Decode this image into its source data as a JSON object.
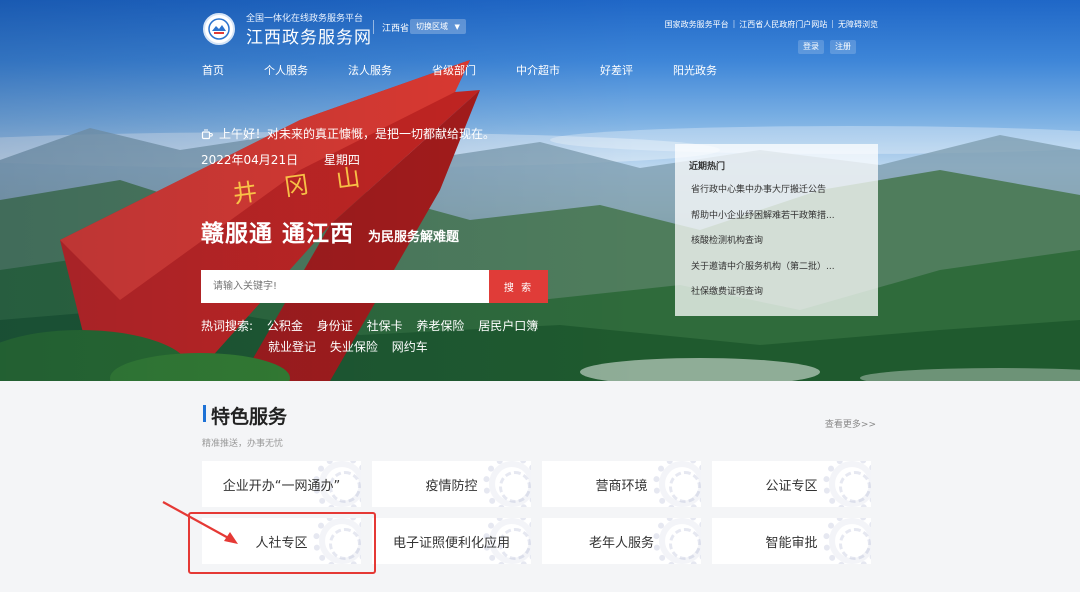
{
  "header": {
    "logo_subtitle": "全国一体化在线政务服务平台",
    "logo_title": "江西政务服务网",
    "region": "江西省",
    "region_switch": "切换区域",
    "top_links": [
      "国家政务服务平台",
      "江西省人民政府门户网站",
      "无障碍浏览"
    ],
    "login": "登录",
    "register": "注册",
    "nav": [
      "首页",
      "个人服务",
      "法人服务",
      "省级部门",
      "中介超市",
      "好差评",
      "阳光政务"
    ]
  },
  "hero": {
    "greeting": "上午好！对未来的真正慷慨，是把一切都献给现在。",
    "date": "2022年04月21日",
    "weekday": "星期四",
    "monument_text": "井冈山",
    "slogan": "赣服通 通江西",
    "slogan_sub": "为民服务解难题",
    "search_placeholder": "请输入关键字!",
    "search_button": "搜 索",
    "hot_label": "热词搜索:",
    "hot_terms_row1": [
      "公积金",
      "身份证",
      "社保卡",
      "养老保险",
      "居民户口簿"
    ],
    "hot_terms_row2": [
      "就业登记",
      "失业保险",
      "网约车"
    ]
  },
  "news": {
    "title": "近期热门",
    "items": [
      "省行政中心集中办事大厅搬迁公告",
      "帮助中小企业纾困解难若干政策措...",
      "核酸检测机构查询",
      "关于邀请中介服务机构（第二批）...",
      "社保缴费证明查询"
    ]
  },
  "features": {
    "title": "特色服务",
    "subtitle": "精准推送，办事无忧",
    "more": "查看更多>>",
    "cards": [
      "企业开办“一网通办”",
      "疫情防控",
      "营商环境",
      "公证专区",
      "人社专区",
      "电子证照便利化应用",
      "老年人服务",
      "智能审批"
    ]
  },
  "colors": {
    "brand_blue": "#1e72d6",
    "search_red": "#e03c38",
    "annotation_red": "#e53935"
  }
}
